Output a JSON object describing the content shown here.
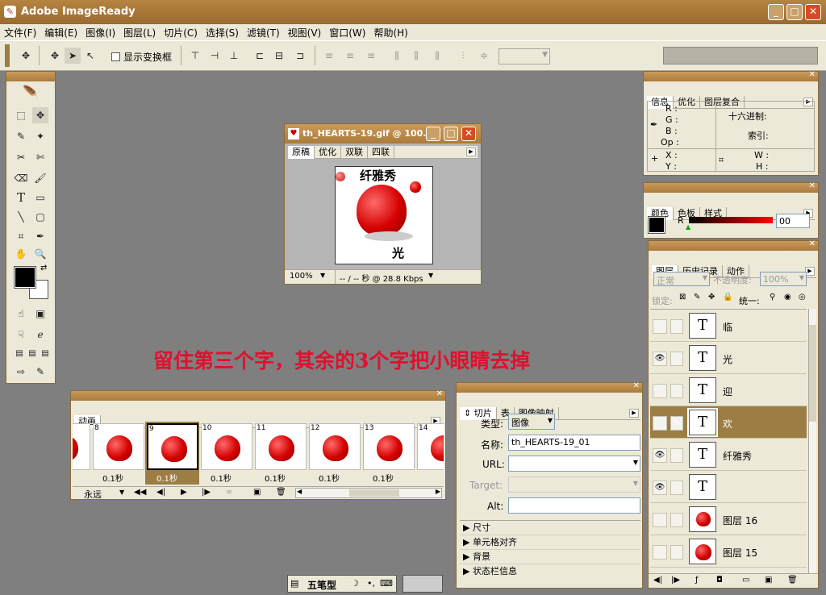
{
  "app": {
    "title": "Adobe ImageReady"
  },
  "menu": [
    "文件(F)",
    "编辑(E)",
    "图像(I)",
    "图层(L)",
    "切片(C)",
    "选择(S)",
    "滤镜(T)",
    "视图(V)",
    "窗口(W)",
    "帮助(H)"
  ],
  "options": {
    "show_transform_label": "显示变换框"
  },
  "image_window": {
    "title": "th_HEARTS-19.gif @ 100...",
    "tabs": [
      "原稿",
      "优化",
      "双联",
      "四联"
    ],
    "zoom": "100%",
    "status": "-- / -- 秒 @ 28.8 Kbps",
    "image_text_top": "纤雅秀",
    "image_text_bottom": "光"
  },
  "annotation": {
    "text": "留住第三个字，其余的3个字把小眼睛去掉",
    "color": "#e0102f"
  },
  "info_panel": {
    "tabs": [
      "信息",
      "优化",
      "图层复合"
    ],
    "labels": {
      "r": "R :",
      "g": "G :",
      "b": "B :",
      "op": "Op :",
      "hex": "十六进制:",
      "index": "索引:",
      "x": "X :",
      "y": "Y :",
      "w": "W :",
      "h": "H :"
    }
  },
  "color_panel": {
    "tabs": [
      "颜色",
      "色板",
      "样式"
    ],
    "channel": "R",
    "value": "00"
  },
  "layers_panel": {
    "tabs": [
      "图层",
      "历史记录",
      "动作"
    ],
    "blend_mode": "正常",
    "opacity_label": "不透明度:",
    "opacity_value": "100%",
    "lock_label": "锁定:",
    "unify_label": "统一:",
    "layers": [
      {
        "name": "临",
        "thumb": "T",
        "visible": false,
        "selected": false
      },
      {
        "name": "光",
        "thumb": "T",
        "visible": true,
        "selected": false
      },
      {
        "name": "迎",
        "thumb": "T",
        "visible": false,
        "selected": false
      },
      {
        "name": "欢",
        "thumb": "T",
        "visible": false,
        "selected": true
      },
      {
        "name": "纤雅秀",
        "thumb": "T",
        "visible": true,
        "selected": false
      },
      {
        "name": "",
        "thumb": "T",
        "visible": true,
        "selected": false
      },
      {
        "name": "图层 16",
        "thumb": "heart",
        "visible": false,
        "selected": false
      },
      {
        "name": "图层 15",
        "thumb": "heart",
        "visible": false,
        "selected": false
      }
    ]
  },
  "animation_panel": {
    "tab": "动画",
    "loop": "永远",
    "frames": [
      {
        "num": "",
        "delay": "0.1秒"
      },
      {
        "num": "8",
        "delay": "0.1秒"
      },
      {
        "num": "9",
        "delay": "0.1秒"
      },
      {
        "num": "10",
        "delay": "0.1秒"
      },
      {
        "num": "11",
        "delay": "0.1秒"
      },
      {
        "num": "12",
        "delay": "0.1秒"
      },
      {
        "num": "13",
        "delay": "0.1秒"
      },
      {
        "num": "14",
        "delay": ""
      }
    ],
    "selected_frame": 2
  },
  "slice_panel": {
    "tabs": [
      "切片",
      "表",
      "图像映射"
    ],
    "type_label": "类型:",
    "type_value": "图像",
    "name_label": "名称:",
    "name_value": "th_HEARTS-19_01",
    "url_label": "URL:",
    "target_label": "Target:",
    "alt_label": "Alt:",
    "sections": [
      "尺寸",
      "单元格对齐",
      "背景",
      "状态栏信息"
    ]
  },
  "taskbar": {
    "ime": "五笔型"
  }
}
